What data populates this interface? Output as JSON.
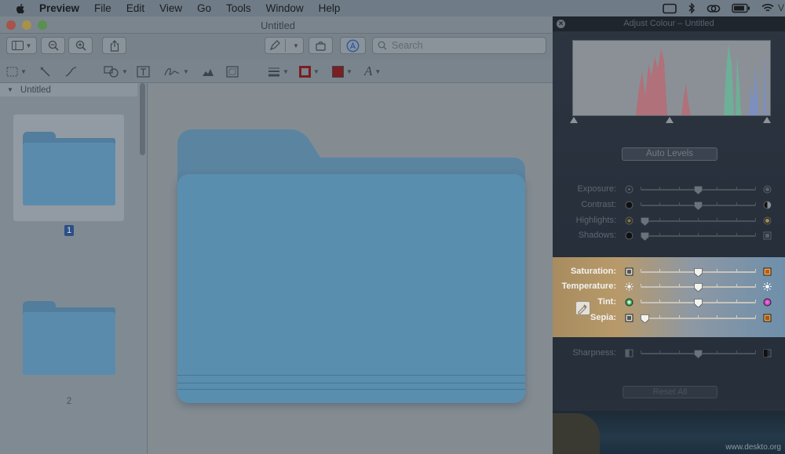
{
  "menubar": {
    "app_name": "Preview",
    "items": [
      "File",
      "Edit",
      "View",
      "Go",
      "Tools",
      "Window",
      "Help"
    ],
    "edge_letter": "V"
  },
  "window": {
    "title": "Untitled",
    "search_placeholder": "Search"
  },
  "sidebar": {
    "header": "Untitled",
    "pages": [
      {
        "label": "1",
        "selected": true
      },
      {
        "label": "2",
        "selected": false
      }
    ]
  },
  "adjust_panel": {
    "title": "Adjust Colour – Untitled",
    "auto_levels": "Auto Levels",
    "sliders": [
      {
        "id": "exposure",
        "label": "Exposure:",
        "value": 0.5
      },
      {
        "id": "contrast",
        "label": "Contrast:",
        "value": 0.5
      },
      {
        "id": "highlights",
        "label": "Highlights:",
        "value": 0.0
      },
      {
        "id": "shadows",
        "label": "Shadows:",
        "value": 0.0
      },
      {
        "id": "saturation",
        "label": "Saturation:",
        "value": 0.5
      },
      {
        "id": "temperature",
        "label": "Temperature:",
        "value": 0.5
      },
      {
        "id": "tint",
        "label": "Tint:",
        "value": 0.5
      },
      {
        "id": "sepia",
        "label": "Sepia:",
        "value": 0.0
      },
      {
        "id": "sharpness",
        "label": "Sharpness:",
        "value": 0.5
      }
    ],
    "reset_all": "Reset All"
  },
  "watermark": "www.deskto.org",
  "colors": {
    "menubar": "#6f7b86",
    "folder_front": "#5a8eae",
    "folder_back": "#5b84a0",
    "highlight_warm": "#b89a6a",
    "highlight_cool": "#6e8fab",
    "selection_badge": "#2c4f86"
  }
}
